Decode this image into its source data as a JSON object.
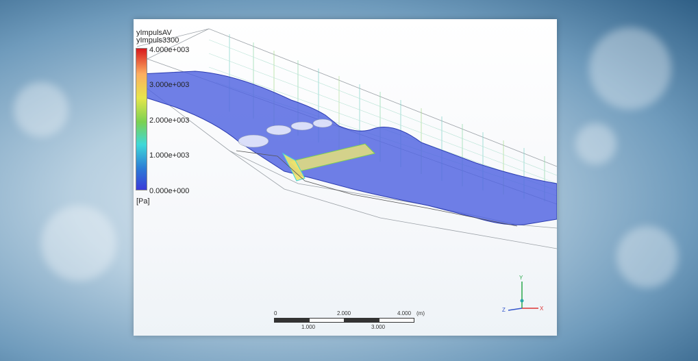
{
  "legend": {
    "title_line1": "yImpulsAV",
    "title_line2": "yImpuls3300",
    "ticks": [
      "4.000e+003",
      "3.000e+003",
      "2.000e+003",
      "1.000e+003",
      "0.000e+000"
    ],
    "unit": "[Pa]",
    "colors": {
      "high": "#d7191c",
      "mid": "#7ad151",
      "low": "#3b3bd8"
    }
  },
  "scale_bar": {
    "top_labels": [
      "0",
      "2.000",
      "4.000"
    ],
    "unit": "(m)",
    "bottom_labels": [
      "1.000",
      "3.000"
    ]
  },
  "axis_triad": {
    "y": "Y",
    "x": "X",
    "z": "Z"
  }
}
